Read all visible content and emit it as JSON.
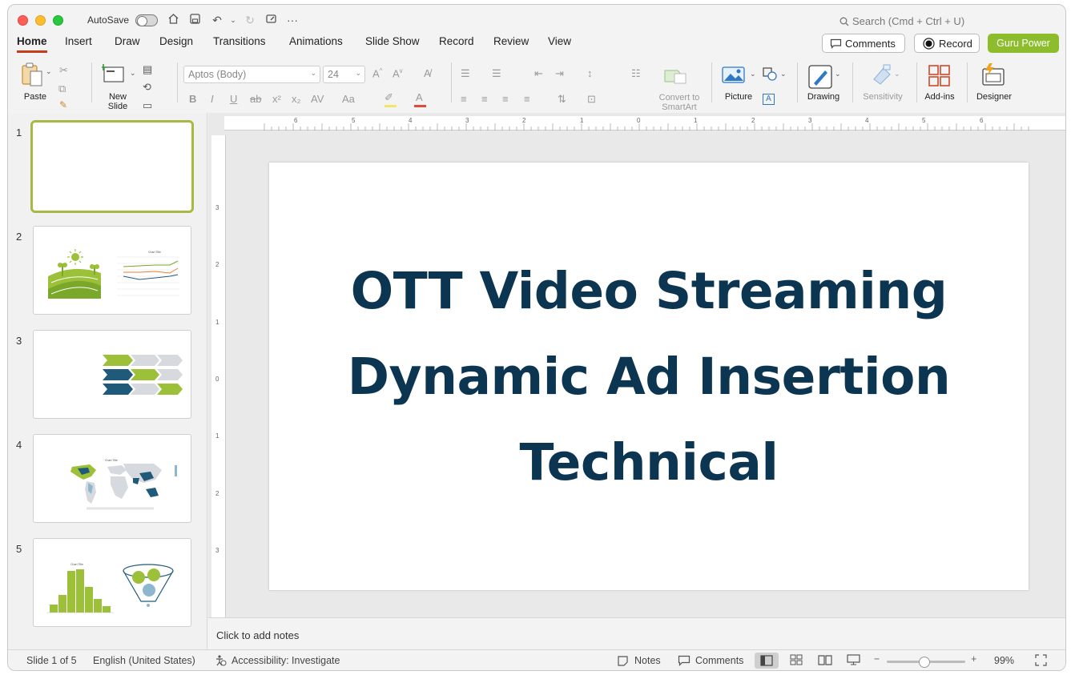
{
  "titlebar": {
    "autosave_label": "AutoSave",
    "search_placeholder": "Search (Cmd + Ctrl + U)"
  },
  "tabs": [
    "Home",
    "Insert",
    "Draw",
    "Design",
    "Transitions",
    "Animations",
    "Slide Show",
    "Record",
    "Review",
    "View"
  ],
  "active_tab": "Home",
  "header_buttons": {
    "comments": "Comments",
    "record": "Record",
    "guru": "Guru Power"
  },
  "ribbon": {
    "paste": "Paste",
    "new_slide_line1": "New",
    "new_slide_line2": "Slide",
    "font_name": "Aptos (Body)",
    "font_size": "24",
    "convert_line1": "Convert to",
    "convert_line2": "SmartArt",
    "picture": "Picture",
    "drawing": "Drawing",
    "sensitivity": "Sensitivity",
    "addins": "Add-ins",
    "designer": "Designer"
  },
  "thumbnails": [
    "1",
    "2",
    "3",
    "4",
    "5"
  ],
  "thumb2": {
    "chart_title": "Chart Title"
  },
  "thumb4": {
    "chart_title": "Chart Title"
  },
  "thumb5": {
    "chart_title": "Chart Title"
  },
  "ruler": {
    "h": [
      "6",
      "5",
      "4",
      "3",
      "2",
      "1",
      "0",
      "1",
      "2",
      "3",
      "4",
      "5",
      "6"
    ],
    "v": [
      "3",
      "2",
      "1",
      "0",
      "1",
      "2",
      "3"
    ]
  },
  "slide": {
    "title_lines": [
      "OTT Video Streaming",
      "Dynamic Ad Insertion",
      "Technical"
    ]
  },
  "notes_placeholder": "Click to add notes",
  "status": {
    "slide_count": "Slide 1 of 5",
    "language": "English (United States)",
    "accessibility": "Accessibility: Investigate",
    "notes": "Notes",
    "comments": "Comments",
    "zoom": "99%"
  },
  "colors": {
    "accent_tab": "#c43e1c",
    "guru_green": "#8dbd2c",
    "title_navy": "#0b3550",
    "thumb_green": "#9cc037",
    "thumb_navy": "#1f5a7a"
  }
}
